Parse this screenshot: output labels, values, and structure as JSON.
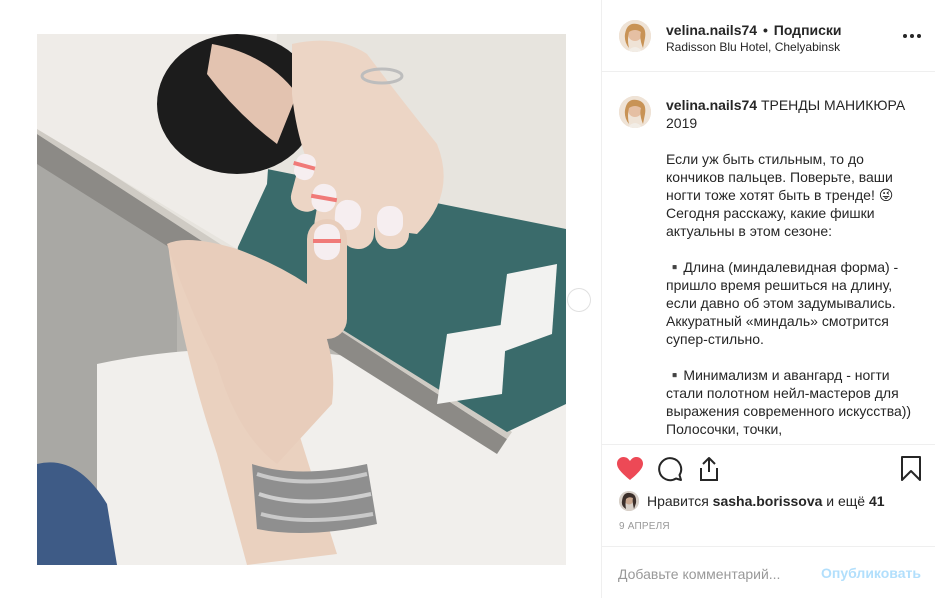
{
  "post": {
    "username": "velina.nails74",
    "follow_separator": "•",
    "follow_label": "Подписки",
    "location": "Radisson Blu Hotel, Chelyabinsk",
    "caption_title": "ТРЕНДЫ МАНИКЮРА 2019",
    "caption_paragraphs": [
      "Если уж быть стильным, то до кончиков пальцев. Поверьте, ваши ногти тоже хотят быть в тренде! 😜 Сегодня расскажу, какие фишки актуальны в этом сезоне:",
      "▪️Длина (миндалевидная форма) - пришло время решиться на длину, если давно об этом задумывались. Аккуратный «миндаль» смотрится супер-стильно.",
      "▪️Минимализм и авангард - ногти стали полотном нейл-мастеров для выражения современного искусства)) Полосочки, точки,"
    ],
    "likes_prefix": "Нравится",
    "likes_user": "sasha.borissova",
    "likes_middle": "и ещё",
    "likes_count": "41",
    "timestamp": "9 АПРЕЛЯ",
    "comment_placeholder": "Добавьте комментарий...",
    "publish_label": "Опубликовать"
  },
  "colors": {
    "heart": "#ed4956",
    "publish_disabled": "#b2dffc",
    "border": "#efefef",
    "muted": "#999999"
  },
  "icons": {
    "more": "more-options-icon",
    "like": "heart-icon",
    "comment": "comment-icon",
    "share": "share-icon",
    "save": "bookmark-icon",
    "next": "chevron-right-icon"
  }
}
